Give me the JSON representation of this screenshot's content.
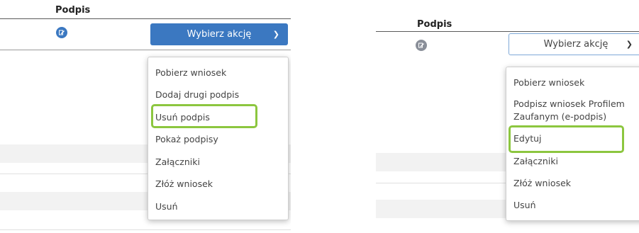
{
  "colors": {
    "accent_blue": "#3b78c1",
    "highlight_green": "#8cc63f",
    "icon_blue": "#3b78c1",
    "icon_gray": "#8a8f99"
  },
  "left": {
    "header": "Podpis",
    "signature_icon": "signature-edit-icon",
    "action_button": "Wybierz akcję",
    "menu": [
      "Pobierz wniosek",
      "Dodaj drugi podpis",
      "Usuń podpis",
      "Pokaż podpisy",
      "Załączniki",
      "Złóż wniosek",
      "Usuń"
    ],
    "highlighted_item": "Usuń podpis"
  },
  "right": {
    "header": "Podpis",
    "signature_icon": "signature-edit-icon",
    "action_button": "Wybierz akcję",
    "menu": [
      "Pobierz wniosek",
      "Podpisz wniosek Profilem",
      "Zaufanym (e-podpis)",
      "Edytuj",
      "Załączniki",
      "Złóż wniosek",
      "Usuń"
    ],
    "highlighted_item": "Edytuj"
  }
}
